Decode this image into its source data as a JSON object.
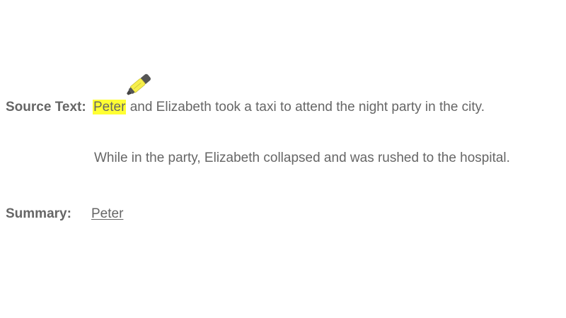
{
  "source": {
    "label": "Source Text:",
    "highlighted_word": "Peter",
    "line1_rest": " and Elizabeth took a taxi to attend the night party in the city.",
    "line2": "While in the party, Elizabeth collapsed and was rushed to the hospital."
  },
  "summary": {
    "label": "Summary:",
    "text": "Peter"
  },
  "icons": {
    "highlighter": "highlighter-marker-icon",
    "highlight_color": "#ffff33"
  }
}
